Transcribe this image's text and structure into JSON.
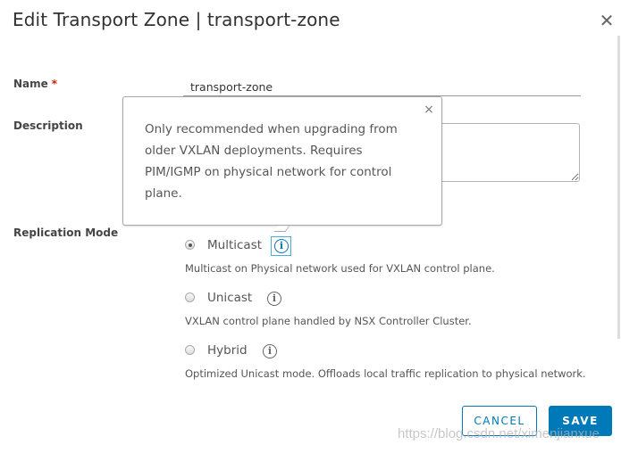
{
  "dialog": {
    "title": "Edit Transport Zone | transport-zone",
    "close_icon": "close-icon"
  },
  "form": {
    "name_label": "Name",
    "required_mark": "*",
    "name_value": "transport-zone",
    "description_label": "Description",
    "description_value": "",
    "replication_label": "Replication Mode",
    "options": [
      {
        "label": "Multicast",
        "description": "Multicast on Physical network used for VXLAN control plane.",
        "selected": true
      },
      {
        "label": "Unicast",
        "description": "VXLAN control plane handled by NSX Controller Cluster.",
        "selected": false
      },
      {
        "label": "Hybrid",
        "description": "Optimized Unicast mode. Offloads local traffic replication to physical network.",
        "selected": false
      }
    ],
    "info_glyph": "i"
  },
  "tooltip": {
    "text": "Only recommended when upgrading from older VXLAN deployments. Requires PIM/IGMP on physical network for control plane.",
    "close": "×"
  },
  "buttons": {
    "cancel": "CANCEL",
    "save": "SAVE"
  },
  "watermark": "https://blog.csdn.net/ximenjianxue",
  "colors": {
    "primary": "#0079b8",
    "required": "#c92100",
    "focus": "#49afd9"
  }
}
